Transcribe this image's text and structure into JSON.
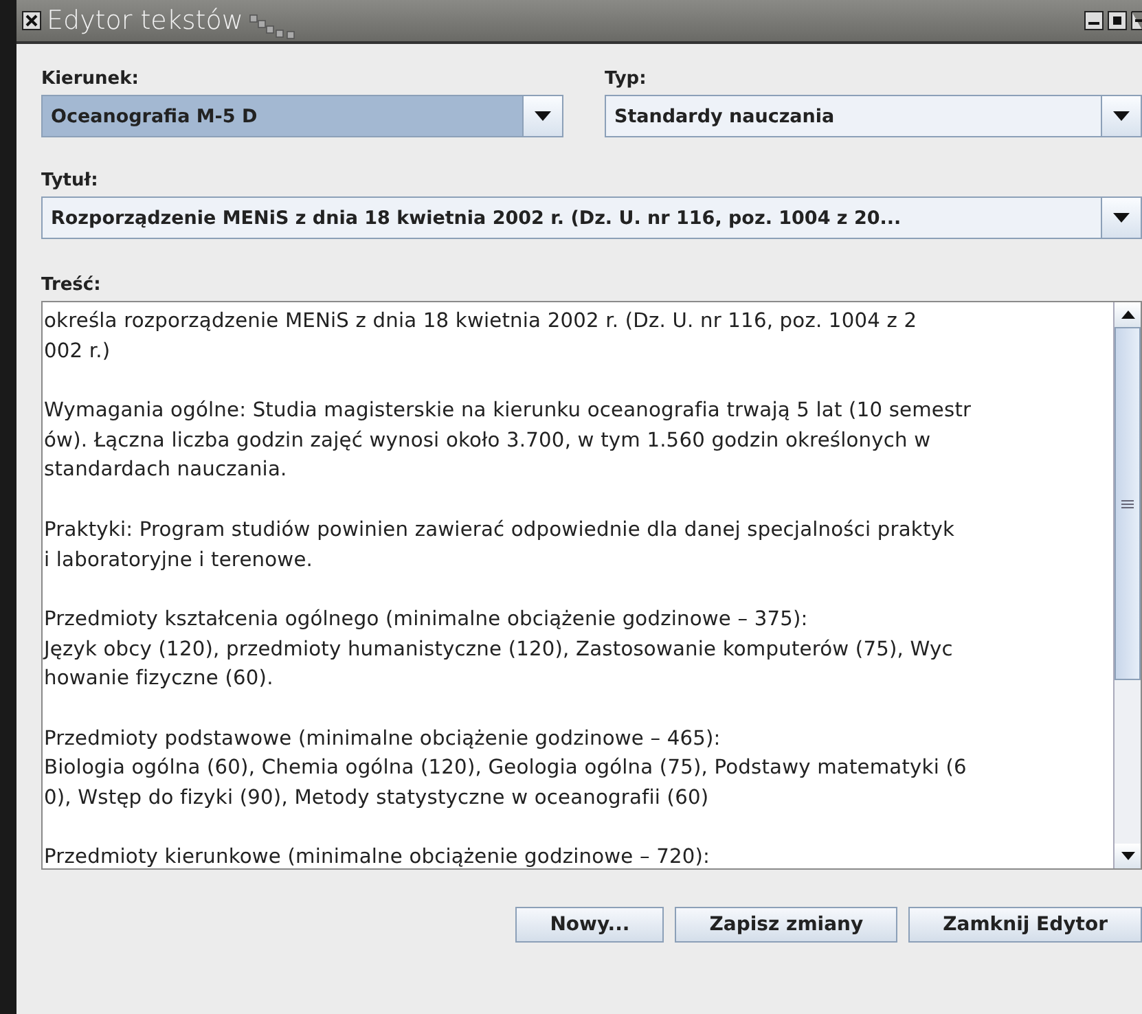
{
  "window": {
    "title": "Edytor tekstów"
  },
  "combos": [
    {
      "label": "Kierunek:",
      "value": "Oceanografia M-5 D",
      "selected": true
    },
    {
      "label": "Typ:",
      "value": "Standardy nauczania",
      "selected": false
    },
    {
      "label": "Tytuł:",
      "value": "Rozporządzenie MENiS z dnia 18 kwietnia 2002 r. (Dz. U. nr 116, poz. 1004 z 20...",
      "selected": false
    }
  ],
  "content": {
    "label": "Treść:",
    "paragraphs": [
      [
        "określa rozporządzenie MENiS z dnia 18 kwietnia 2002 r. (Dz. U. nr 116, poz. 1004 z 2",
        "002 r.)"
      ],
      [
        "Wymagania ogólne: Studia magisterskie na kierunku oceanografia trwają 5 lat (10 semestr",
        "ów). Łączna liczba godzin zajęć wynosi około 3.700, w tym 1.560 godzin określonych w",
        "standardach nauczania."
      ],
      [
        "Praktyki: Program studiów powinien zawierać odpowiednie dla danej specjalności praktyk",
        "i laboratoryjne i terenowe."
      ],
      [
        "Przedmioty kształcenia ogólnego (minimalne obciążenie godzinowe – 375):",
        "Język obcy (120), przedmioty humanistyczne (120), Zastosowanie komputerów (75), Wyc",
        "howanie fizyczne (60)."
      ],
      [
        "Przedmioty podstawowe (minimalne obciążenie godzinowe – 465):",
        "Biologia ogólna (60), Chemia ogólna (120), Geologia ogólna (75), Podstawy matematyki (6",
        "0), Wstęp do fizyki (90), Metody statystyczne w oceanografii (60)"
      ],
      [
        "Przedmioty kierunkowe (minimalne obciążenie godzinowe – 720):"
      ]
    ]
  },
  "buttons": [
    "Nowy...",
    "Zapisz zmiany",
    "Zamknij Edytor"
  ]
}
